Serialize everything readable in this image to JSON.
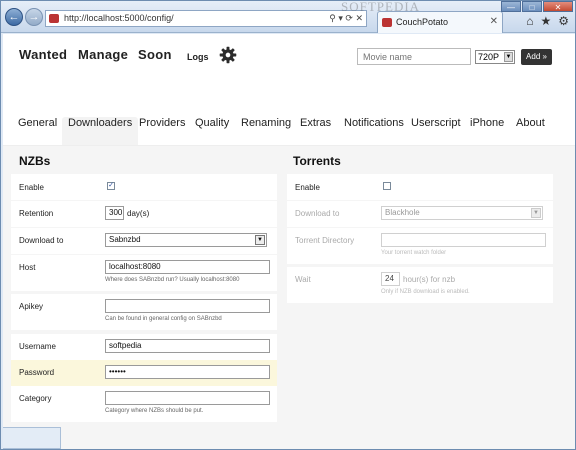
{
  "browser": {
    "address": "http://localhost:5000/config/",
    "address_tools": "⚲ ▾ ⟳ ✕",
    "tab_title": "CouchPotato",
    "watermark": "SOFTPEDIA",
    "back_icon": "←",
    "forward_icon": "→",
    "tab_close": "✕",
    "win_min": "—",
    "win_max": "□",
    "win_close": "✕",
    "home_icon": "⌂",
    "star_icon": "★",
    "gear_icon": "⚙"
  },
  "header": {
    "nav": [
      "Wanted",
      "Manage",
      "Soon"
    ],
    "logs": "Logs",
    "movie_placeholder": "Movie name",
    "quality": "720P",
    "add_label": "Add »"
  },
  "tabs": [
    "General",
    "Downloaders",
    "Providers",
    "Quality",
    "Renaming",
    "Extras",
    "Notifications",
    "Userscript",
    "iPhone",
    "About"
  ],
  "nzbs": {
    "title": "NZBs",
    "enable_label": "Enable",
    "enable_checked": "✓",
    "retention_label": "Retention",
    "retention_value": "300",
    "retention_unit": "day(s)",
    "download_to_label": "Download to",
    "download_to_value": "Sabnzbd",
    "host_label": "Host",
    "host_value": "localhost:8080",
    "host_hint": "Where does SABnzbd run? Usually localhost:8080",
    "apikey_label": "Apikey",
    "apikey_value": "",
    "apikey_hint": "Can be found in general config on SABnzbd",
    "username_label": "Username",
    "username_value": "softpedia",
    "password_label": "Password",
    "password_value": "••••••",
    "category_label": "Category",
    "category_value": "",
    "category_hint": "Category where NZBs should be put."
  },
  "torrents": {
    "title": "Torrents",
    "enable_label": "Enable",
    "download_to_label": "Download to",
    "download_to_value": "Blackhole",
    "directory_label": "Torrent Directory",
    "directory_value": "",
    "directory_hint": "Your torrent watch folder",
    "wait_label": "Wait",
    "wait_value": "24",
    "wait_unit": "hour(s) for nzb",
    "wait_hint": "Only if NZB download is enabled."
  },
  "colors": {
    "accent_dark": "#333333",
    "highlight_row": "#fbf7dc",
    "checkbox_mark": "#2a4ea0"
  }
}
